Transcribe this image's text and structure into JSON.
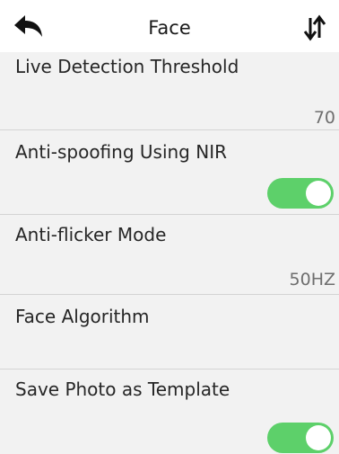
{
  "header": {
    "title": "Face",
    "back_icon": "back-arrow-icon",
    "sort_icon": "sort-icon"
  },
  "settings": [
    {
      "label": "Live Detection Threshold",
      "value": "70"
    },
    {
      "label": "Anti-spoofing Using NIR",
      "toggle": "on"
    },
    {
      "label": "Anti-flicker Mode",
      "value": "50HZ"
    },
    {
      "label": "Face Algorithm"
    },
    {
      "label": "Save Photo as Template",
      "toggle": "on"
    }
  ],
  "colors": {
    "toggle_on": "#5dd06a",
    "background": "#f2f2f2",
    "header": "#ffffff"
  }
}
